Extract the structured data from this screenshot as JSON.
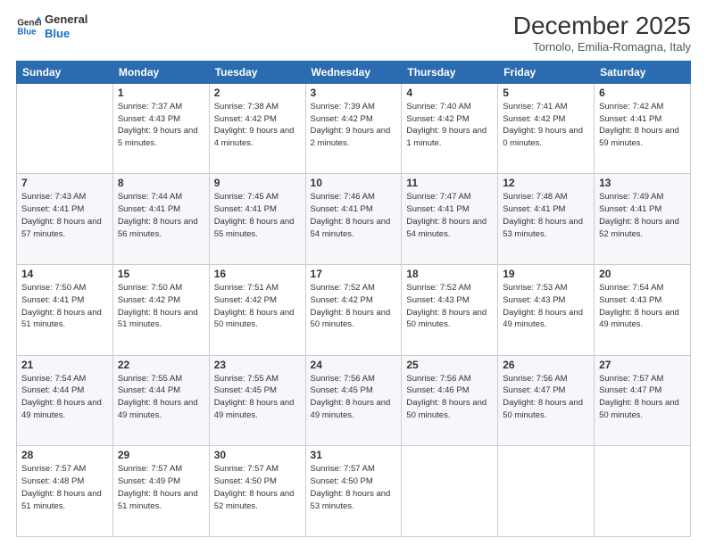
{
  "logo": {
    "line1": "General",
    "line2": "Blue"
  },
  "title": "December 2025",
  "location": "Tornolo, Emilia-Romagna, Italy",
  "days_header": [
    "Sunday",
    "Monday",
    "Tuesday",
    "Wednesday",
    "Thursday",
    "Friday",
    "Saturday"
  ],
  "weeks": [
    [
      {
        "day": "",
        "sunrise": "",
        "sunset": "",
        "daylight": ""
      },
      {
        "day": "1",
        "sunrise": "7:37 AM",
        "sunset": "4:43 PM",
        "daylight": "9 hours and 5 minutes."
      },
      {
        "day": "2",
        "sunrise": "7:38 AM",
        "sunset": "4:42 PM",
        "daylight": "9 hours and 4 minutes."
      },
      {
        "day": "3",
        "sunrise": "7:39 AM",
        "sunset": "4:42 PM",
        "daylight": "9 hours and 2 minutes."
      },
      {
        "day": "4",
        "sunrise": "7:40 AM",
        "sunset": "4:42 PM",
        "daylight": "9 hours and 1 minute."
      },
      {
        "day": "5",
        "sunrise": "7:41 AM",
        "sunset": "4:42 PM",
        "daylight": "9 hours and 0 minutes."
      },
      {
        "day": "6",
        "sunrise": "7:42 AM",
        "sunset": "4:41 PM",
        "daylight": "8 hours and 59 minutes."
      }
    ],
    [
      {
        "day": "7",
        "sunrise": "7:43 AM",
        "sunset": "4:41 PM",
        "daylight": "8 hours and 57 minutes."
      },
      {
        "day": "8",
        "sunrise": "7:44 AM",
        "sunset": "4:41 PM",
        "daylight": "8 hours and 56 minutes."
      },
      {
        "day": "9",
        "sunrise": "7:45 AM",
        "sunset": "4:41 PM",
        "daylight": "8 hours and 55 minutes."
      },
      {
        "day": "10",
        "sunrise": "7:46 AM",
        "sunset": "4:41 PM",
        "daylight": "8 hours and 54 minutes."
      },
      {
        "day": "11",
        "sunrise": "7:47 AM",
        "sunset": "4:41 PM",
        "daylight": "8 hours and 54 minutes."
      },
      {
        "day": "12",
        "sunrise": "7:48 AM",
        "sunset": "4:41 PM",
        "daylight": "8 hours and 53 minutes."
      },
      {
        "day": "13",
        "sunrise": "7:49 AM",
        "sunset": "4:41 PM",
        "daylight": "8 hours and 52 minutes."
      }
    ],
    [
      {
        "day": "14",
        "sunrise": "7:50 AM",
        "sunset": "4:41 PM",
        "daylight": "8 hours and 51 minutes."
      },
      {
        "day": "15",
        "sunrise": "7:50 AM",
        "sunset": "4:42 PM",
        "daylight": "8 hours and 51 minutes."
      },
      {
        "day": "16",
        "sunrise": "7:51 AM",
        "sunset": "4:42 PM",
        "daylight": "8 hours and 50 minutes."
      },
      {
        "day": "17",
        "sunrise": "7:52 AM",
        "sunset": "4:42 PM",
        "daylight": "8 hours and 50 minutes."
      },
      {
        "day": "18",
        "sunrise": "7:52 AM",
        "sunset": "4:43 PM",
        "daylight": "8 hours and 50 minutes."
      },
      {
        "day": "19",
        "sunrise": "7:53 AM",
        "sunset": "4:43 PM",
        "daylight": "8 hours and 49 minutes."
      },
      {
        "day": "20",
        "sunrise": "7:54 AM",
        "sunset": "4:43 PM",
        "daylight": "8 hours and 49 minutes."
      }
    ],
    [
      {
        "day": "21",
        "sunrise": "7:54 AM",
        "sunset": "4:44 PM",
        "daylight": "8 hours and 49 minutes."
      },
      {
        "day": "22",
        "sunrise": "7:55 AM",
        "sunset": "4:44 PM",
        "daylight": "8 hours and 49 minutes."
      },
      {
        "day": "23",
        "sunrise": "7:55 AM",
        "sunset": "4:45 PM",
        "daylight": "8 hours and 49 minutes."
      },
      {
        "day": "24",
        "sunrise": "7:56 AM",
        "sunset": "4:45 PM",
        "daylight": "8 hours and 49 minutes."
      },
      {
        "day": "25",
        "sunrise": "7:56 AM",
        "sunset": "4:46 PM",
        "daylight": "8 hours and 50 minutes."
      },
      {
        "day": "26",
        "sunrise": "7:56 AM",
        "sunset": "4:47 PM",
        "daylight": "8 hours and 50 minutes."
      },
      {
        "day": "27",
        "sunrise": "7:57 AM",
        "sunset": "4:47 PM",
        "daylight": "8 hours and 50 minutes."
      }
    ],
    [
      {
        "day": "28",
        "sunrise": "7:57 AM",
        "sunset": "4:48 PM",
        "daylight": "8 hours and 51 minutes."
      },
      {
        "day": "29",
        "sunrise": "7:57 AM",
        "sunset": "4:49 PM",
        "daylight": "8 hours and 51 minutes."
      },
      {
        "day": "30",
        "sunrise": "7:57 AM",
        "sunset": "4:50 PM",
        "daylight": "8 hours and 52 minutes."
      },
      {
        "day": "31",
        "sunrise": "7:57 AM",
        "sunset": "4:50 PM",
        "daylight": "8 hours and 53 minutes."
      },
      {
        "day": "",
        "sunrise": "",
        "sunset": "",
        "daylight": ""
      },
      {
        "day": "",
        "sunrise": "",
        "sunset": "",
        "daylight": ""
      },
      {
        "day": "",
        "sunrise": "",
        "sunset": "",
        "daylight": ""
      }
    ]
  ],
  "sunrise_label": "Sunrise:",
  "sunset_label": "Sunset:",
  "daylight_label": "Daylight:"
}
